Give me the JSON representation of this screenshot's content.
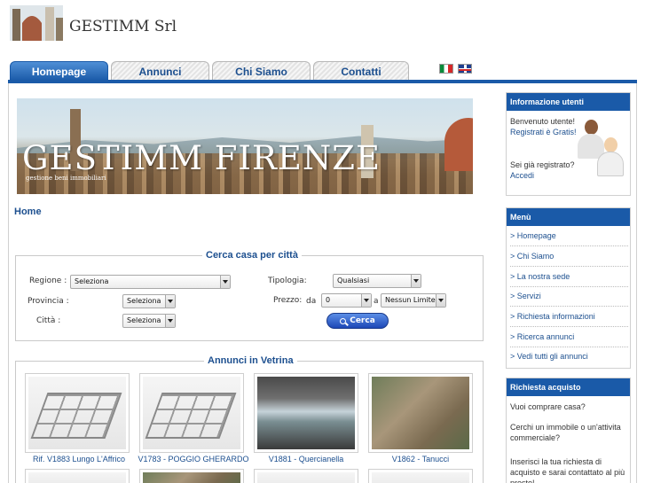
{
  "header": {
    "title": "GESTIMM Srl",
    "logo_icon": "duomo-logo-icon"
  },
  "tabs": [
    {
      "label": "Homepage",
      "active": true
    },
    {
      "label": "Annunci",
      "active": false
    },
    {
      "label": "Chi Siamo",
      "active": false
    },
    {
      "label": "Contatti",
      "active": false
    }
  ],
  "languages": [
    "italian-flag-icon",
    "uk-flag-icon"
  ],
  "banner": {
    "title": "GESTIMM FIRENZE",
    "subtitle": "gestione beni immobiliari"
  },
  "breadcrumb": "Home",
  "search": {
    "legend": "Cerca casa per città",
    "regione_label": "Regione :",
    "regione_value": "Seleziona",
    "provincia_label": "Provincia :",
    "provincia_value": "Seleziona",
    "citta_label": "Città :",
    "citta_value": "Seleziona",
    "tipologia_label": "Tipologia:",
    "tipologia_value": "Qualsiasi",
    "prezzo_label": "Prezzo:",
    "da_label": "da",
    "da_value": "0",
    "a_label": "a",
    "a_value": "Nessun Limite",
    "button_label": "Cerca"
  },
  "vetrina": {
    "legend": "Annunci in Vetrina",
    "items": [
      {
        "caption": "Rif. V1883 Lungo L'Affrico",
        "image": "floorplan-render"
      },
      {
        "caption": "V1783 - POGGIO GHERARDO",
        "image": "floorplan-render"
      },
      {
        "caption": "V1881 - Quercianella",
        "image": "sea-view-photo"
      },
      {
        "caption": "V1862 - Tanucci",
        "image": "aerial-city-photo"
      }
    ]
  },
  "sidebar": {
    "utenti": {
      "title": "Informazione utenti",
      "welcome": "Benvenuto utente!",
      "register_link": "Registrati è Gratis!",
      "already": "Sei già registrato?",
      "login_link": "Accedi"
    },
    "menu": {
      "title": "Menù",
      "items": [
        "> Homepage",
        "> Chi Siamo",
        "> La nostra sede",
        "> Servizi",
        "> Richiesta informazioni",
        "> Ricerca annunci",
        "> Vedi tutti gli annunci"
      ]
    },
    "acquisto": {
      "title": "Richiesta acquisto",
      "line1": "Vuoi comprare casa?",
      "line2": "Cerchi un immobile o un'attivita commerciale?",
      "line3": "Inserisci la tua richiesta di acquisto e sarai contattato al più presto!"
    }
  },
  "colors": {
    "brand_blue": "#1a5aa8",
    "link_blue": "#1c4f8f"
  }
}
